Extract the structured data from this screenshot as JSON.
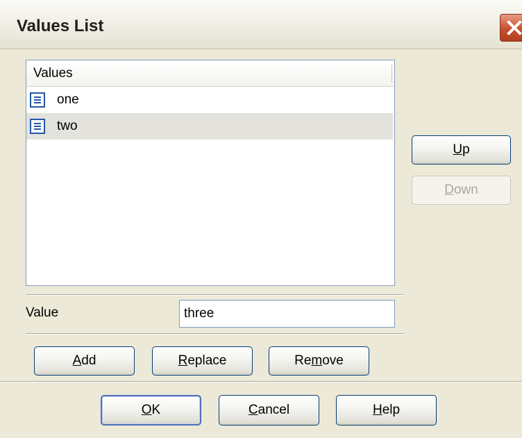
{
  "window": {
    "title": "Values List"
  },
  "list": {
    "header": "Values",
    "items": [
      {
        "icon": "list-item-icon",
        "label": "one",
        "selected": false
      },
      {
        "icon": "list-item-icon",
        "label": "two",
        "selected": true
      }
    ]
  },
  "value_field": {
    "label": "Value",
    "value": "three"
  },
  "buttons": {
    "up": {
      "mnemonic": "U",
      "rest": "p",
      "enabled": true
    },
    "down": {
      "mnemonic": "D",
      "rest": "own",
      "enabled": false
    },
    "add": {
      "mnemonic": "A",
      "rest": "dd"
    },
    "replace": {
      "mnemonic": "R",
      "rest": "eplace"
    },
    "remove": {
      "pre": "Re",
      "mnemonic": "m",
      "rest": "ove"
    },
    "ok": {
      "mnemonic": "O",
      "rest": "K"
    },
    "cancel": {
      "mnemonic": "C",
      "rest": "ancel"
    },
    "help": {
      "mnemonic": "H",
      "rest": "elp"
    }
  },
  "colors": {
    "accent": "#2356a8",
    "close_button": "#c4512f",
    "dialog_bg": "#ece9d8"
  }
}
